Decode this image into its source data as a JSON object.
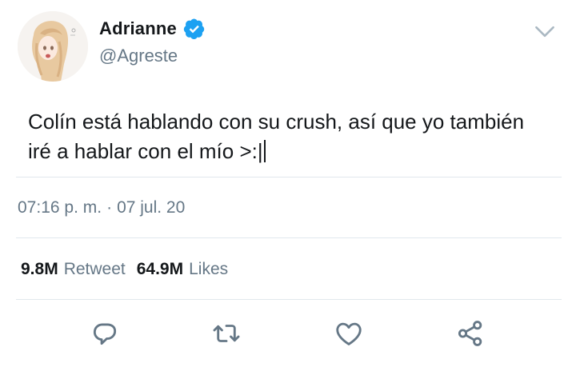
{
  "tweet": {
    "author": {
      "display_name": "Adrianne",
      "handle": "@Agreste",
      "verified": true,
      "avatar_icon": "anime-girl-avatar"
    },
    "text": "Colín está hablando con su crush, así que yo también iré a hablar con el mío >:|",
    "time": "07:16 p. m.",
    "separator": "·",
    "date": "07 jul. 20",
    "stats": {
      "retweets_count": "9.8M",
      "retweets_label": "Retweet",
      "likes_count": "64.9M",
      "likes_label": "Likes"
    }
  },
  "actions": [
    "reply-icon",
    "retweet-icon",
    "like-icon",
    "share-icon"
  ],
  "colors": {
    "text": "#14171a",
    "secondary": "#657786",
    "verified": "#1da1f2",
    "divider": "#e1e8ed",
    "icon": "#657786"
  }
}
